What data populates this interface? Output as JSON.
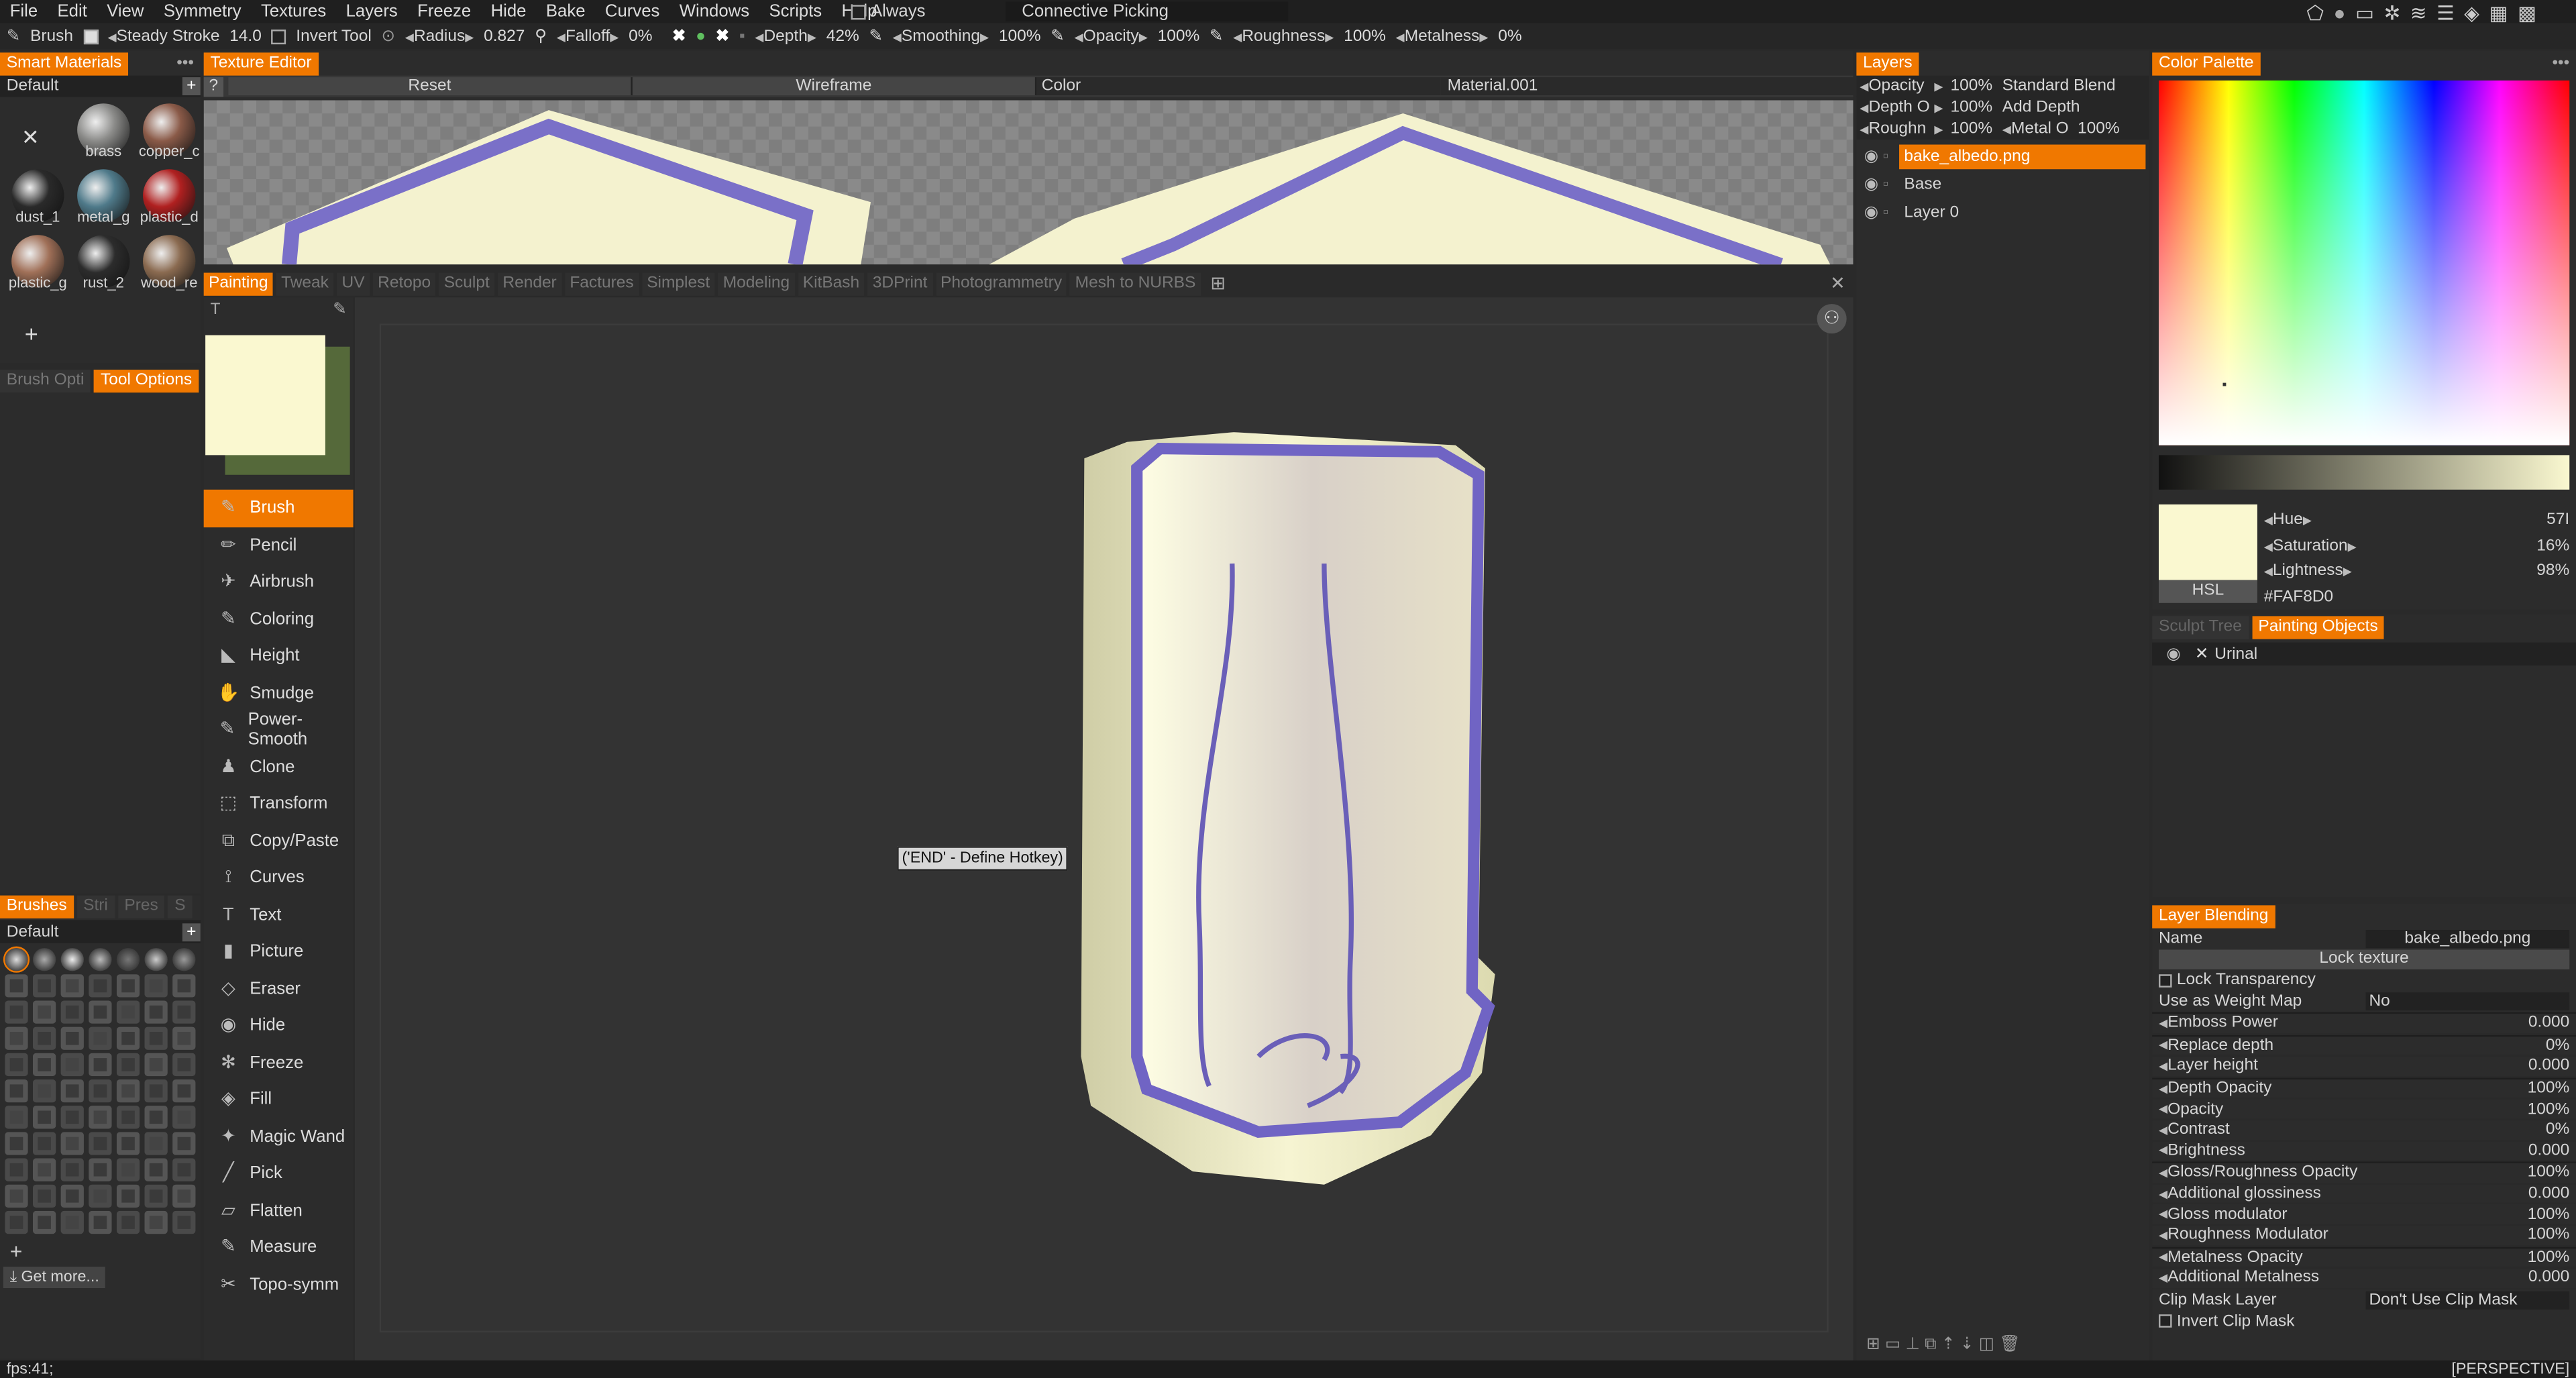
{
  "menu": [
    "File",
    "Edit",
    "View",
    "Symmetry",
    "Textures",
    "Layers",
    "Freeze",
    "Hide",
    "Bake",
    "Curves",
    "Windows",
    "Scripts",
    "Help"
  ],
  "menu_extra": {
    "always": "Always",
    "picking": "Connective Picking"
  },
  "toolbar": {
    "brush": "Brush",
    "steady_stroke": "Steady Stroke",
    "steady_val": "14.0",
    "invert_tool": "Invert Tool",
    "radius_label": "Radius",
    "radius_val": "0.827",
    "falloff_label": "Falloff",
    "falloff_val": "0%",
    "depth_label": "Depth",
    "depth_val": "42%",
    "smoothing_label": "Smoothing",
    "smoothing_val": "100%",
    "opacity_label": "Opacity",
    "opacity_val": "100%",
    "roughness_label": "Roughness",
    "roughness_val": "100%",
    "metalness_label": "Metalness",
    "metalness_val": "0%"
  },
  "smart_materials": {
    "title": "Smart Materials",
    "preset": "Default",
    "items": [
      {
        "label": "brass",
        "color": "#8a8a88"
      },
      {
        "label": "copper_c",
        "color": "#8a5a48"
      },
      {
        "label": "dust_1",
        "color": "#2a2a2a"
      },
      {
        "label": "metal_g",
        "color": "#4f7a8a"
      },
      {
        "label": "plastic_d",
        "color": "#b02020"
      },
      {
        "label": "plastic_g",
        "color": "#a07058"
      },
      {
        "label": "rust_2",
        "color": "#2c2c2c"
      },
      {
        "label": "wood_re",
        "color": "#8a6a50"
      }
    ]
  },
  "left_tabs": {
    "brush_options": "Brush Opti",
    "tool_options": "Tool Options"
  },
  "brushes": {
    "title": "Brushes",
    "tabs": [
      "Stri",
      "Pres",
      "S"
    ],
    "preset": "Default",
    "get_more": "Get more..."
  },
  "texture_editor": {
    "title": "Texture Editor",
    "reset": "Reset",
    "wireframe": "Wireframe",
    "color": "Color",
    "material": "Material.001"
  },
  "rooms": [
    "Painting",
    "Tweak",
    "UV",
    "Retopo",
    "Sculpt",
    "Render",
    "Factures",
    "Simplest",
    "Modeling",
    "KitBash",
    "3DPrint",
    "Photogrammetry",
    "Mesh  to  NURBS"
  ],
  "tools": [
    "Brush",
    "Pencil",
    "Airbrush",
    "Coloring",
    "Height",
    "Smudge",
    "Power-Smooth",
    "Clone",
    "Transform",
    "Copy/Paste",
    "Curves",
    "Text",
    "Picture",
    "Eraser",
    "Hide",
    "Freeze",
    "Fill",
    "Magic Wand",
    "Pick",
    "Flatten",
    "Measure",
    "Topo-symm"
  ],
  "tool_icons": [
    "brush-icon",
    "pencil-icon",
    "airbrush-icon",
    "coloring-icon",
    "height-icon",
    "smudge-icon",
    "power-smooth-icon",
    "clone-icon",
    "transform-icon",
    "copy-paste-icon",
    "curves-icon",
    "text-icon",
    "picture-icon",
    "eraser-icon",
    "hide-icon",
    "freeze-icon",
    "fill-icon",
    "magic-wand-icon",
    "pick-icon",
    "flatten-icon",
    "measure-icon",
    "topo-symm-icon"
  ],
  "viewport": {
    "hotkey_tip": "('END' - Define Hotkey)",
    "mode": "[PERSPECTIVE]"
  },
  "status": {
    "fps": "fps:41;"
  },
  "layers": {
    "title": "Layers",
    "props": [
      {
        "label": "Opacity",
        "value": "100%",
        "mode": "Standard Blend"
      },
      {
        "label": "Depth O",
        "value": "100%",
        "mode": "Add Depth"
      },
      {
        "label": "Roughn",
        "value": "100%",
        "label2": "Metal O",
        "value2": "100%"
      }
    ],
    "items": [
      {
        "name": "bake_albedo.png",
        "selected": true
      },
      {
        "name": "Base",
        "selected": false
      },
      {
        "name": "Layer 0",
        "selected": false
      }
    ]
  },
  "color_palette": {
    "title": "Color Palette",
    "hue_label": "Hue",
    "hue": "57I",
    "sat_label": "Saturation",
    "sat": "16%",
    "light_label": "Lightness",
    "light": "98%",
    "mode": "HSL",
    "hex": "#FAF8D0",
    "current": "#FAF8D0"
  },
  "objects": {
    "tabs": [
      "Sculpt  Tree",
      "Painting Objects"
    ],
    "items": [
      "Urinal"
    ]
  },
  "layer_blending": {
    "title": "Layer Blending",
    "name_label": "Name",
    "name_val": "bake_albedo.png",
    "lock_texture": "Lock texture",
    "lock_transparency": "Lock Transparency",
    "weight_map_label": "Use as Weight Map",
    "weight_map_val": "No",
    "rows": [
      {
        "name": "Emboss Power",
        "v": "0.000"
      },
      {
        "name": "Replace depth",
        "v": "0%"
      },
      {
        "name": "Layer height",
        "v": "0.000"
      },
      {
        "name": "Depth Opacity",
        "v": "100%"
      },
      {
        "name": "Opacity",
        "v": "100%"
      },
      {
        "name": "Contrast",
        "v": "0%"
      },
      {
        "name": "Brightness",
        "v": "0.000"
      },
      {
        "name": "Gloss/Roughness Opacity",
        "v": "100%"
      },
      {
        "name": "Additional glossiness",
        "v": "0.000"
      },
      {
        "name": "Gloss modulator",
        "v": "100%"
      },
      {
        "name": "Roughness Modulator",
        "v": "100%"
      },
      {
        "name": "Metalness Opacity",
        "v": "100%"
      },
      {
        "name": "Additional Metalness",
        "v": "0.000"
      }
    ],
    "clip_label": "Clip Mask Layer",
    "clip_val": "Don't  Use  Clip  Mask",
    "invert_clip": "Invert  Clip  Mask"
  },
  "colors": {
    "accent": "#F07800",
    "panel": "#2C2C2C",
    "viewport": "#333333",
    "layer_selected": "#F07800"
  }
}
